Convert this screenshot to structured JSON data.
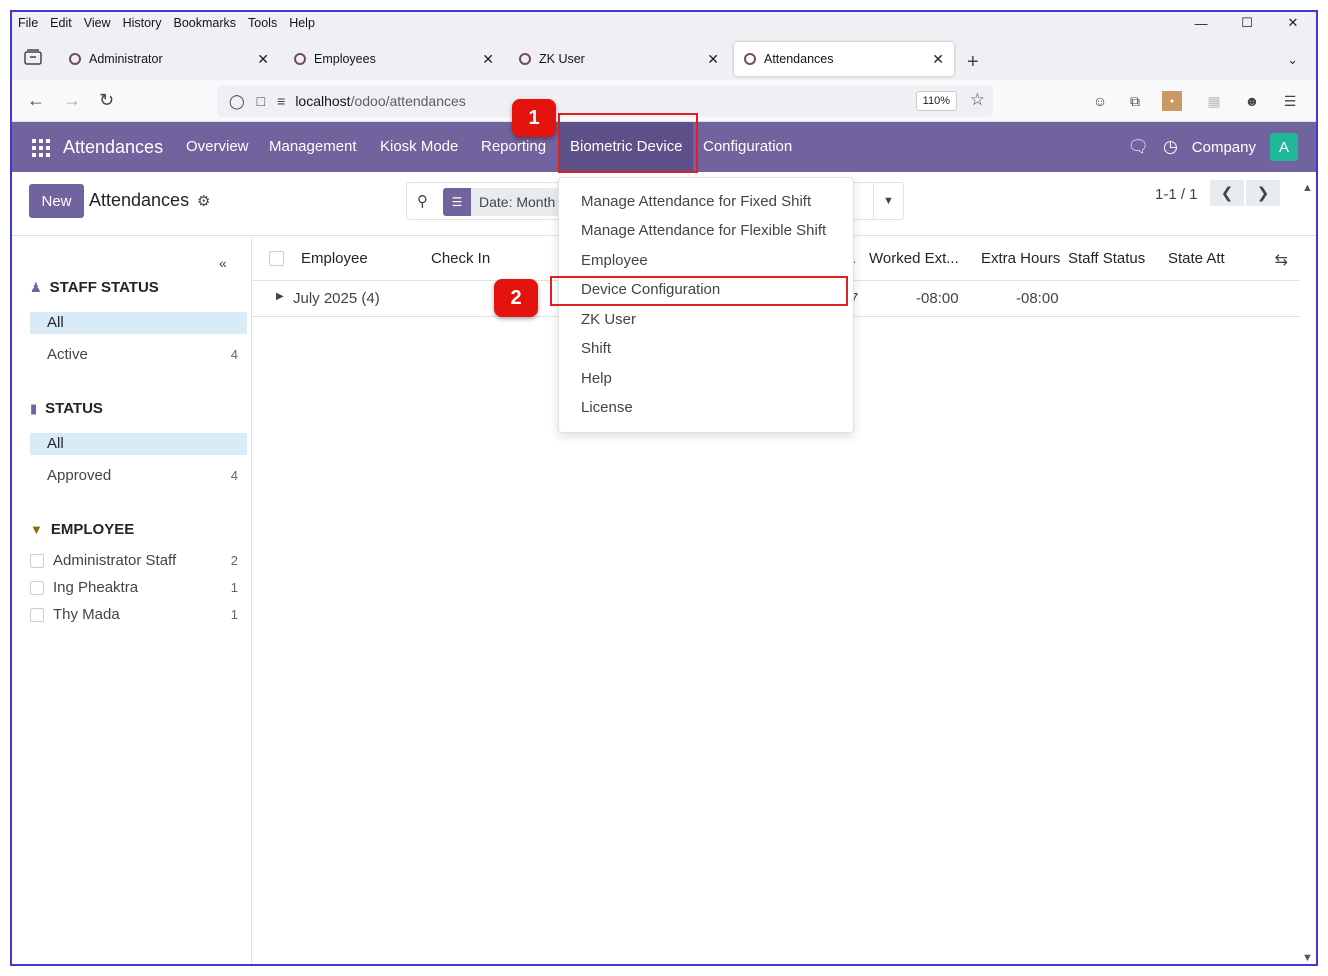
{
  "browser": {
    "menu": [
      "File",
      "Edit",
      "View",
      "History",
      "Bookmarks",
      "Tools",
      "Help"
    ],
    "tabs": [
      {
        "label": "Administrator",
        "active": false
      },
      {
        "label": "Employees",
        "active": false
      },
      {
        "label": "ZK User",
        "active": false
      },
      {
        "label": "Attendances",
        "active": true
      }
    ],
    "url_host": "localhost",
    "url_path": "/odoo/attendances",
    "zoom": "110%"
  },
  "app": {
    "brand": "Attendances",
    "menus": [
      "Overview",
      "Management",
      "Kiosk Mode",
      "Reporting",
      "Biometric Device",
      "Configuration"
    ],
    "company": "Company",
    "avatar_letter": "A",
    "accent": "#71639e"
  },
  "control_panel": {
    "new_label": "New",
    "title": "Attendances",
    "facet": "Date: Month",
    "pager": "1-1 / 1"
  },
  "sidebar": {
    "staff_status": {
      "title": "STAFF STATUS",
      "items": [
        {
          "label": "All",
          "count": ""
        },
        {
          "label": "Active",
          "count": "4"
        }
      ]
    },
    "status": {
      "title": "STATUS",
      "items": [
        {
          "label": "All",
          "count": ""
        },
        {
          "label": "Approved",
          "count": "4"
        }
      ]
    },
    "employee": {
      "title": "EMPLOYEE",
      "items": [
        {
          "label": "Administrator Staff",
          "count": "2"
        },
        {
          "label": "Ing Pheaktra",
          "count": "1"
        },
        {
          "label": "Thy Mada",
          "count": "1"
        }
      ]
    }
  },
  "list": {
    "columns": [
      "Employee",
      "Check In",
      ".",
      "Worked Ext...",
      "Extra Hours",
      "Staff Status",
      "State Att"
    ],
    "group": {
      "label": "July 2025 (4)",
      "partial": "7",
      "worked_extra": "-08:00",
      "extra_hours": "-08:00"
    }
  },
  "dropdown": {
    "items": [
      "Manage Attendance for Fixed Shift",
      "Manage Attendance for Flexible Shift",
      "Employee",
      "Device Configuration",
      "ZK User",
      "Shift",
      "Help",
      "License"
    ]
  },
  "annotations": {
    "step1": "1",
    "step2": "2",
    "highlight_color": "#e02020"
  }
}
